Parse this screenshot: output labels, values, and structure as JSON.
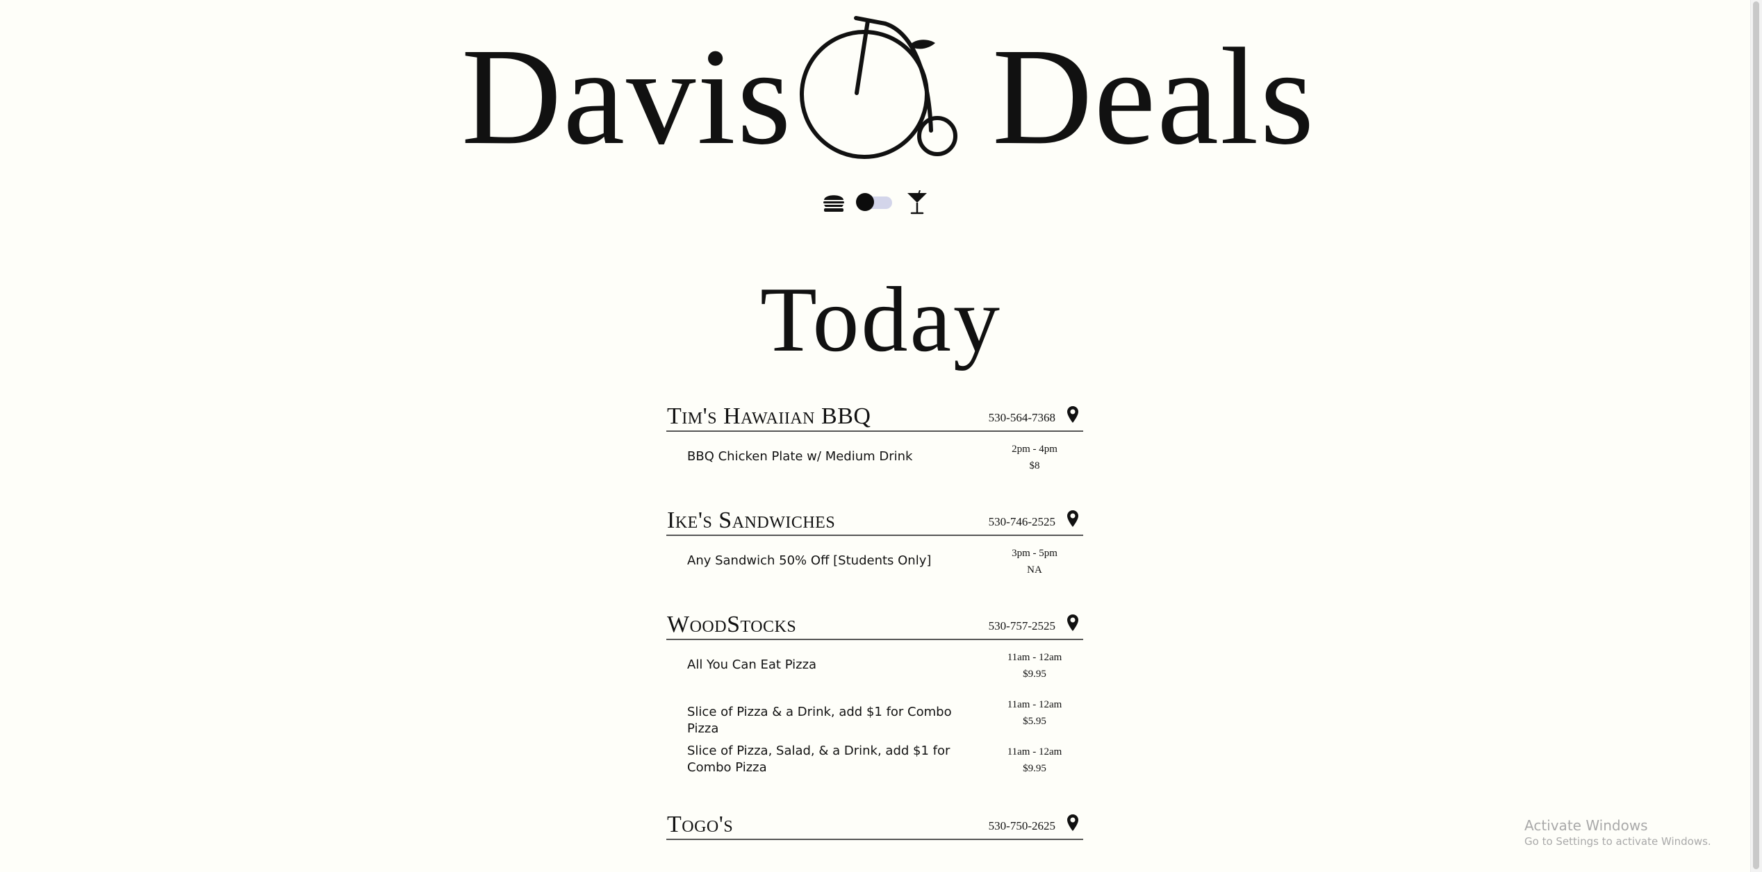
{
  "header": {
    "logo_left": "Davis",
    "logo_right": "Deals",
    "logo_icon": "penny-farthing-bicycle",
    "toggle": {
      "left_icon": "burger-icon",
      "right_icon": "martini-icon",
      "state": "food",
      "track_color": "#d3d5ea",
      "knob_color": "#0c0c0c"
    }
  },
  "main": {
    "title": "Today",
    "restaurants": [
      {
        "name": "Tim's Hawaiian BBQ",
        "phone": "530-564-7368",
        "map_icon": "map-pin-icon",
        "deals": [
          {
            "description": "BBQ Chicken Plate w/ Medium Drink",
            "time": "2pm - 4pm",
            "price": "$8"
          }
        ]
      },
      {
        "name": "Ike's Sandwiches",
        "phone": "530-746-2525",
        "map_icon": "map-pin-icon",
        "deals": [
          {
            "description": "Any Sandwich 50% Off [Students Only]",
            "time": "3pm - 5pm",
            "price": "NA"
          }
        ]
      },
      {
        "name": "WoodStocks",
        "phone": "530-757-2525",
        "map_icon": "map-pin-icon",
        "deals": [
          {
            "description": "All You Can Eat Pizza",
            "time": "11am - 12am",
            "price": "$9.95"
          },
          {
            "description": "Slice of Pizza & a Drink, add $1 for Combo Pizza",
            "time": "11am - 12am",
            "price": "$5.95"
          },
          {
            "description": "Slice of Pizza, Salad, & a Drink, add $1 for Combo Pizza",
            "time": "11am - 12am",
            "price": "$9.95"
          }
        ]
      },
      {
        "name": "Togo's",
        "phone": "530-750-2625",
        "map_icon": "map-pin-icon",
        "deals": []
      }
    ]
  },
  "system": {
    "watermark_line1": "Activate Windows",
    "watermark_line2": "Go to Settings to activate Windows."
  },
  "colors": {
    "background": "#fefef9",
    "text": "#111111",
    "divider": "#555555"
  }
}
